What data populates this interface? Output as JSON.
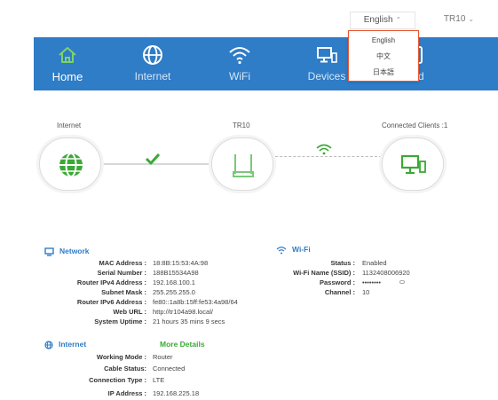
{
  "colors": {
    "nav_blue": "#2f7cc7",
    "accent_orange": "#e8542f",
    "ok_green": "#3aa935",
    "section_blue": "#2f7cc7"
  },
  "topbar": {
    "language": "English",
    "model": "TR10"
  },
  "language_menu": {
    "options": [
      "English",
      "中文",
      "日本語"
    ]
  },
  "nav": [
    {
      "label": "Home",
      "icon": "home-icon",
      "active": true
    },
    {
      "label": "Internet",
      "icon": "globe-icon",
      "active": false
    },
    {
      "label": "WiFi",
      "icon": "wifi-icon",
      "active": false
    },
    {
      "label": "Devices",
      "icon": "devices-icon",
      "active": false
    },
    {
      "label": "ced",
      "icon": "advanced-icon",
      "active": false
    }
  ],
  "topology": {
    "internet_label": "Internet",
    "router_label": "TR10",
    "clients_label": "Connected Clients :1"
  },
  "network": {
    "title": "Network",
    "fields": [
      {
        "key": "MAC Address :",
        "value": "18:8B:15:53:4A:98"
      },
      {
        "key": "Serial Number :",
        "value": "188B15534A98"
      },
      {
        "key": "Router IPv4 Address :",
        "value": "192.168.100.1"
      },
      {
        "key": "Subnet Mask :",
        "value": "255.255.255.0"
      },
      {
        "key": "Router IPv6 Address :",
        "value": "fe80::1a8b:15ff:fe53:4a98/64"
      },
      {
        "key": "Web URL :",
        "value": "http://tr104a98.local/"
      },
      {
        "key": "System Uptime :",
        "value": "21 hours 35 mins 9 secs"
      }
    ]
  },
  "wifi": {
    "title": "Wi-Fi",
    "fields": [
      {
        "key": "Status :",
        "value": "Enabled"
      },
      {
        "key": "Wi-Fi Name (SSID) :",
        "value": "1132408006920"
      },
      {
        "key": "Password :",
        "value": "••••••••"
      },
      {
        "key": "Channel :",
        "value": "10"
      }
    ]
  },
  "internet": {
    "title": "Internet",
    "more_details": "More Details",
    "fields": [
      {
        "key": "Working Mode :",
        "value": "Router"
      },
      {
        "key": "Cable Status:",
        "value": "Connected"
      },
      {
        "key": "Connection Type :",
        "value": "LTE"
      },
      {
        "key": "IP Address :",
        "value": "192.168.225.18"
      }
    ]
  }
}
